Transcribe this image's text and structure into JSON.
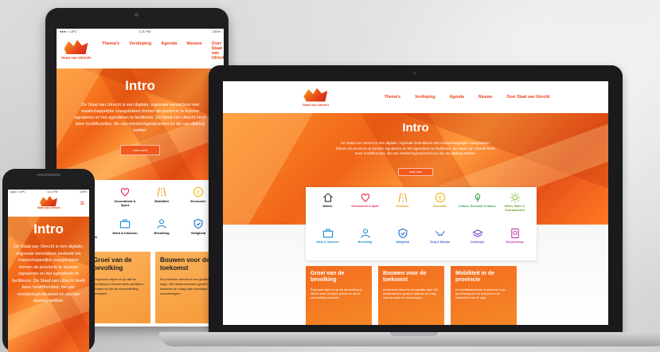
{
  "site": {
    "logo_text": "Staat van Utrecht",
    "nav": [
      "Thema's",
      "Verdieping",
      "Agenda",
      "Nieuws",
      "Over Staat van Utrecht"
    ],
    "hero_title": "Intro",
    "hero_text": "De Staat van Utrecht is een digitale, regionale kennisbron met maatschappelijke vraagstukken binnen de provincie te kunnen signaleren en het agenderen te faciliteren. De Staat van Utrecht heeft twee hoofdfuncties: die van monitoringinstrument en die van dialoog wekker.",
    "cta": "Lees meer",
    "categories": [
      {
        "label": "Wonen",
        "icon": "house-icon"
      },
      {
        "label": "Gezondheid & Sport",
        "icon": "heart-icon"
      },
      {
        "label": "Mobiliteit",
        "icon": "road-icon"
      },
      {
        "label": "Economie",
        "icon": "euro-icon"
      },
      {
        "label": "Cultuur, Recreatie & Natuur",
        "icon": "leaf-icon"
      },
      {
        "label": "Milieu, Water & Duurzaamheid",
        "icon": "sun-icon"
      },
      {
        "label": "Werk & Inkomen",
        "icon": "briefcase-icon"
      },
      {
        "label": "Bevolking",
        "icon": "person-icon"
      },
      {
        "label": "Veiligheid",
        "icon": "shield-icon"
      },
      {
        "label": "Zorg & Welzijn",
        "icon": "hands-icon"
      },
      {
        "label": "Onderwijs",
        "icon": "books-icon"
      },
      {
        "label": "Burgerschap",
        "icon": "passport-icon"
      }
    ],
    "cards": [
      {
        "title": "Groei van de bevolking",
        "text": "Prognoses wijzen er op dat de bevolking in Utrecht sterk zal blijven groeien en dat de samenstelling verandert."
      },
      {
        "title": "Bouwen voor de toekomst",
        "text": "De provincie Utrecht is een gewilde regio. Het aantal inwoners groeit en daarmee de vraag naar woningen en voorzieningen."
      },
      {
        "title": "Mobiliteit in de provincie",
        "text": "De bereikbaarheid van de provincie is van groot belang voor de economie en de leefbaarheid van de regio."
      }
    ]
  },
  "tablet": {
    "status_left": "●●●○○ UPC",
    "status_time": "4:21 PM",
    "status_right": "100%"
  },
  "phone": {
    "status_left": "●●●○○ UPC",
    "status_time": "4:21 PM",
    "status_right": "100%",
    "hero_text": "De Staat van Utrecht is een digitale, regionale kennisbron bedoeld om maatschappelijke vraagstukken binnen de provincie te kunnen signaleren en het agenderen te faciliteren. De Staat van Utrecht heeft twee hoofdfuncties: die van monitoringinstrument en die van dialoog wekker."
  },
  "colors": {
    "brand": "#e8431a",
    "accent": "#f58a27"
  }
}
